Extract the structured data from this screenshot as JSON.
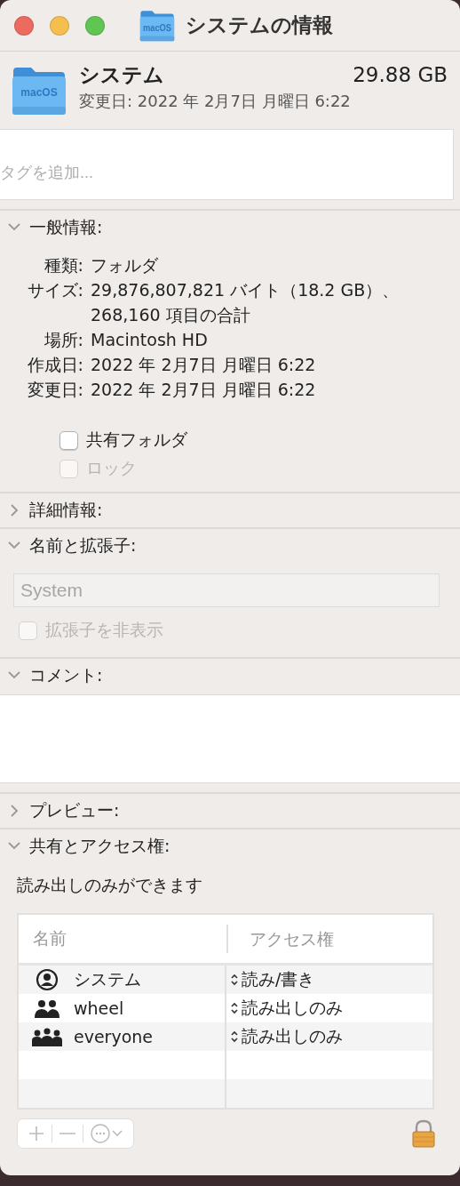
{
  "window": {
    "title": "システムの情報",
    "icon_label": "macOS"
  },
  "header": {
    "icon_label": "macOS",
    "name": "システム",
    "size": "29.88 GB",
    "modified": "変更日: 2022 年 2月7日 月曜日 6:22"
  },
  "tags": {
    "placeholder": "タグを追加..."
  },
  "sections": [
    {
      "kind": "general",
      "title": "一般情報:",
      "expanded": true,
      "rows": [
        {
          "label": "種類:",
          "value": "フォルダ"
        },
        {
          "label": "サイズ:",
          "value": "29,876,807,821 バイト（18.2 GB）、",
          "value_cont": "268,160 項目の合計"
        },
        {
          "label": "場所:",
          "value": "Macintosh HD"
        },
        {
          "label": "作成日:",
          "value": "2022 年 2月7日 月曜日 6:22"
        },
        {
          "label": "変更日:",
          "value": "2022 年 2月7日 月曜日 6:22"
        }
      ],
      "checkboxes": [
        {
          "label": "共有フォルダ",
          "checked": false,
          "disabled": false
        },
        {
          "label": "ロック",
          "checked": false,
          "disabled": true
        }
      ]
    },
    {
      "kind": "more",
      "title": "詳細情報:",
      "expanded": false
    },
    {
      "kind": "name",
      "title": "名前と拡張子:",
      "expanded": true,
      "field": {
        "value": "System",
        "disabled": true
      },
      "checkboxes": [
        {
          "label": "拡張子を非表示",
          "checked": false,
          "disabled": true
        }
      ]
    },
    {
      "kind": "comment",
      "title": "コメント:",
      "expanded": true
    },
    {
      "kind": "preview",
      "title": "プレビュー:",
      "expanded": false
    },
    {
      "kind": "sharing",
      "title": "共有とアクセス権:",
      "expanded": true,
      "note": "読み出しのみができます",
      "columns": [
        "名前",
        "アクセス権"
      ],
      "rows": [
        {
          "kind": "user",
          "name": "システム",
          "access": "読み/書き"
        },
        {
          "kind": "group",
          "name": "wheel",
          "access": "読み出しのみ"
        },
        {
          "kind": "everyone",
          "name": "everyone",
          "access": "読み出しのみ"
        }
      ],
      "locked": true
    }
  ]
}
